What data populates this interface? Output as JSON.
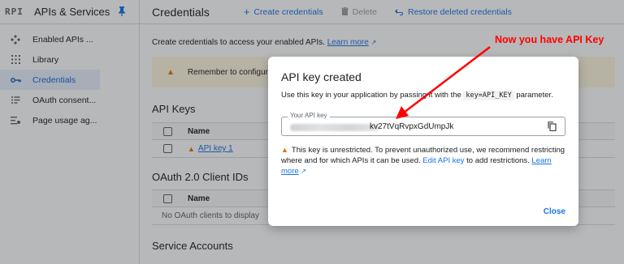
{
  "sidebar": {
    "logo": "RPI",
    "title": "APIs & Services",
    "items": [
      {
        "icon": "enabled-apis-icon",
        "label": "Enabled APIs ..."
      },
      {
        "icon": "library-icon",
        "label": "Library"
      },
      {
        "icon": "key-icon",
        "label": "Credentials"
      },
      {
        "icon": "oauth-consent-icon",
        "label": "OAuth consent..."
      },
      {
        "icon": "page-usage-icon",
        "label": "Page usage ag..."
      }
    ]
  },
  "toolbar": {
    "title": "Credentials",
    "create_label": "Create credentials",
    "delete_label": "Delete",
    "restore_label": "Restore deleted credentials"
  },
  "main": {
    "intro_text": "Create credentials to access your enabled APIs.",
    "learn_more": "Learn more",
    "banner_text": "Remember to configure",
    "api_keys_heading": "API Keys",
    "api_keys_col": "Name",
    "api_key_row": "API key 1",
    "oauth_heading": "OAuth 2.0 Client IDs",
    "oauth_col": "Name",
    "oauth_empty": "No OAuth clients to display",
    "service_heading": "Service Accounts"
  },
  "dialog": {
    "title": "API key created",
    "desc_before": "Use this key in your application by passing it with the",
    "desc_code": "key=API_KEY",
    "desc_after": "parameter.",
    "field_label": "Your API key",
    "field_value_visible": "kv27tVqRvpxGdUmpJk",
    "warning_text": "This key is unrestricted. To prevent unauthorized use, we recommend restricting where and for which APIs it can be used.",
    "edit_link": "Edit API key",
    "warning_after": "to add restrictions.",
    "learn_more": "Learn more",
    "close_label": "Close"
  },
  "annotation": {
    "text": "Now you have API Key",
    "color": "#ff0000"
  },
  "colors": {
    "accent": "#1a73e8",
    "active_bg": "#e8f0fe",
    "warning": "#e37400",
    "banner_bg": "#fef7e0"
  }
}
